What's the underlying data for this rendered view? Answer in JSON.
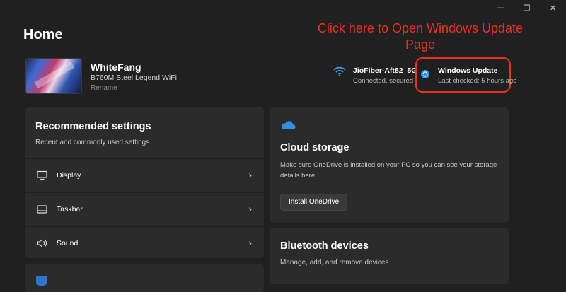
{
  "window": {
    "minimize_glyph": "—",
    "restore_glyph": "❐",
    "close_glyph": "✕"
  },
  "header": {
    "title": "Home"
  },
  "annotation": {
    "text": "Click here to Open Windows Update Page",
    "color": "#e8321e"
  },
  "device": {
    "name": "WhiteFang",
    "model": "B760M Steel Legend WiFi",
    "rename_label": "Rename"
  },
  "network": {
    "icon": "wifi-icon",
    "name": "JioFiber-Aft82_5G",
    "status": "Connected, secured"
  },
  "windows_update": {
    "icon": "update-icon",
    "title": "Windows Update",
    "status": "Last checked: 5 hours ago"
  },
  "recommended": {
    "title": "Recommended settings",
    "subtitle": "Recent and commonly used settings",
    "items": [
      {
        "label": "Display",
        "icon": "monitor-icon"
      },
      {
        "label": "Taskbar",
        "icon": "taskbar-icon"
      },
      {
        "label": "Sound",
        "icon": "speaker-icon"
      }
    ],
    "chevron": "›"
  },
  "cloud": {
    "icon": "cloud-icon",
    "title": "Cloud storage",
    "description": "Make sure OneDrive is installed on your PC so you can see your storage details here.",
    "button_label": "Install OneDrive"
  },
  "bluetooth": {
    "title": "Bluetooth devices",
    "description": "Manage, add, and remove devices"
  },
  "colors": {
    "accent": "#2f8fe6",
    "background": "#202020",
    "card": "#2b2b2b",
    "highlight": "#e8321e"
  }
}
